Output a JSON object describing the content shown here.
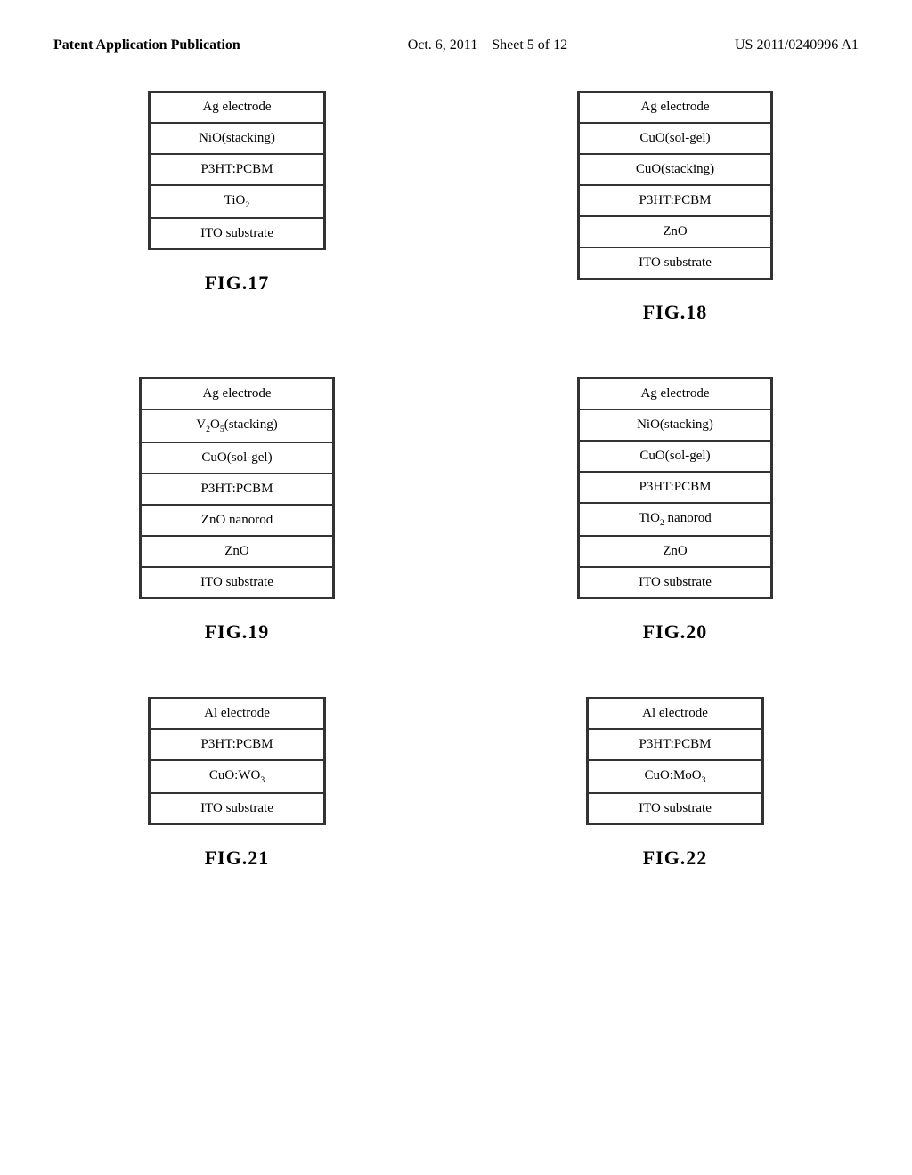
{
  "header": {
    "left": "Patent Application Publication",
    "center_date": "Oct. 6, 2011",
    "center_sheet": "Sheet 5 of 12",
    "right": "US 2011/0240996 A1"
  },
  "figures": [
    {
      "id": "fig17",
      "label": "FIG.17",
      "layers": [
        "Ag electrode",
        "NiO(stacking)",
        "P3HT:PCBM",
        "TiO₂",
        "ITO substrate"
      ]
    },
    {
      "id": "fig18",
      "label": "FIG.18",
      "layers": [
        "Ag electrode",
        "CuO(sol-gel)",
        "CuO(stacking)",
        "P3HT:PCBM",
        "ZnO",
        "ITO substrate"
      ]
    },
    {
      "id": "fig19",
      "label": "FIG.19",
      "layers": [
        "Ag electrode",
        "V₂O₅(stacking)",
        "CuO(sol-gel)",
        "P3HT:PCBM",
        "ZnO nanorod",
        "ZnO",
        "ITO substrate"
      ]
    },
    {
      "id": "fig20",
      "label": "FIG.20",
      "layers": [
        "Ag electrode",
        "NiO(stacking)",
        "CuO(sol-gel)",
        "P3HT:PCBM",
        "TiO₂ nanorod",
        "ZnO",
        "ITO substrate"
      ]
    },
    {
      "id": "fig21",
      "label": "FIG.21",
      "layers": [
        "Al electrode",
        "P3HT:PCBM",
        "CuO:WO₃",
        "ITO substrate"
      ]
    },
    {
      "id": "fig22",
      "label": "FIG.22",
      "layers": [
        "Al electrode",
        "P3HT:PCBM",
        "CuO:MoO₃",
        "ITO substrate"
      ]
    }
  ]
}
